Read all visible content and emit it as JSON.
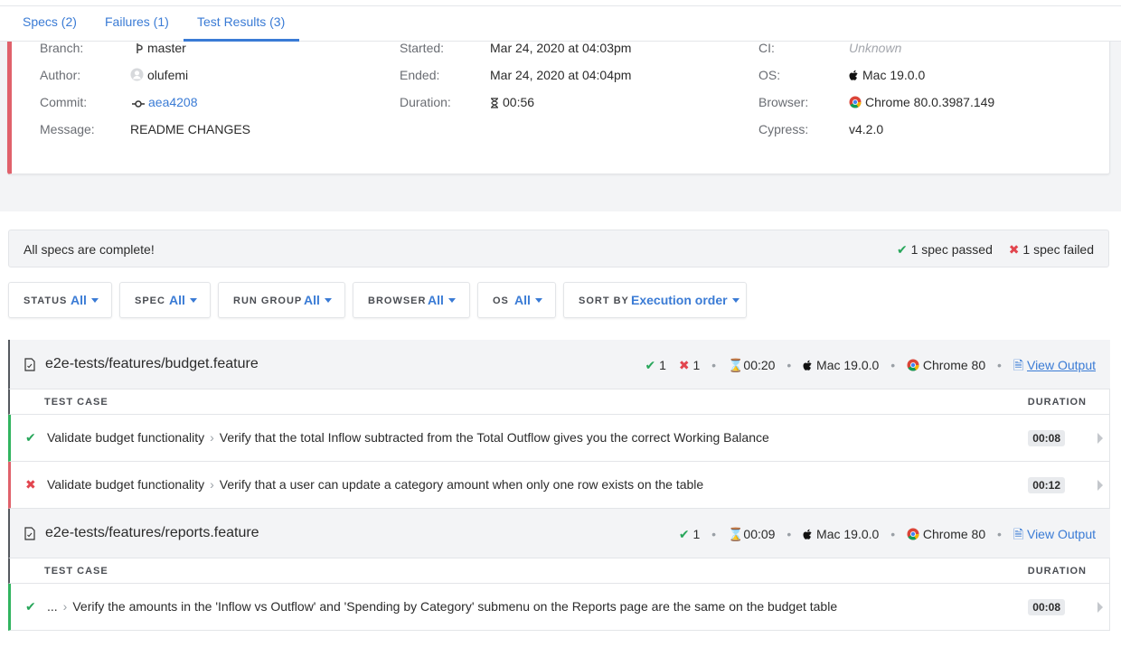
{
  "tabs": [
    {
      "label": "Specs (2)"
    },
    {
      "label": "Failures (1)"
    },
    {
      "label": "Test Results (3)"
    }
  ],
  "run": {
    "branch_label": "Branch:",
    "branch": "master",
    "author_label": "Author:",
    "author": "olufemi",
    "commit_label": "Commit:",
    "commit": "aea4208",
    "message_label": "Message:",
    "message": "README CHANGES",
    "started_label": "Started:",
    "started": "Mar 24, 2020 at 04:03pm",
    "ended_label": "Ended:",
    "ended": "Mar 24, 2020 at 04:04pm",
    "duration_label": "Duration:",
    "duration": "00:56",
    "ci_label": "CI:",
    "ci": "Unknown",
    "os_label": "OS:",
    "os": "Mac 19.0.0",
    "browser_label": "Browser:",
    "browser": "Chrome 80.0.3987.149",
    "cypress_label": "Cypress:",
    "cypress": "v4.2.0"
  },
  "status": {
    "text": "All specs are complete!",
    "passed": "1 spec passed",
    "failed": "1 spec failed"
  },
  "filters": [
    {
      "label": "STATUS",
      "value": "All"
    },
    {
      "label": "SPEC",
      "value": "All"
    },
    {
      "label": "RUN GROUP",
      "value": "All"
    },
    {
      "label": "BROWSER",
      "value": "All"
    },
    {
      "label": "OS",
      "value": "All"
    },
    {
      "label": "SORT BY",
      "value": "Execution order"
    }
  ],
  "specs": [
    {
      "title": "e2e-tests/features/budget.feature",
      "passed": "1",
      "failed": "1",
      "duration": "00:20",
      "os": "Mac 19.0.0",
      "browser": "Chrome 80",
      "view_output": "View Output",
      "col_test_case": "TEST CASE",
      "col_duration": "DURATION",
      "rows": [
        {
          "suite": "Validate budget functionality",
          "test": "Verify that the total Inflow subtracted from the Total Outflow gives you the correct Working Balance",
          "duration": "00:08"
        },
        {
          "suite": "Validate budget functionality",
          "test": "Verify that a user can update a category amount when only one row exists on the table",
          "duration": "00:12"
        }
      ]
    },
    {
      "title": "e2e-tests/features/reports.feature",
      "passed": "1",
      "duration": "00:09",
      "os": "Mac 19.0.0",
      "browser": "Chrome 80",
      "view_output": "View Output",
      "col_test_case": "TEST CASE",
      "col_duration": "DURATION",
      "rows": [
        {
          "suite": "...",
          "test": "Verify the amounts in the 'Inflow vs Outflow' and 'Spending by Category' submenu on the Reports page are the same on the budget table",
          "duration": "00:08"
        }
      ]
    }
  ],
  "colors": {
    "accent": "#3a7bd5",
    "pass": "#27a65a",
    "fail": "#e2454e"
  }
}
